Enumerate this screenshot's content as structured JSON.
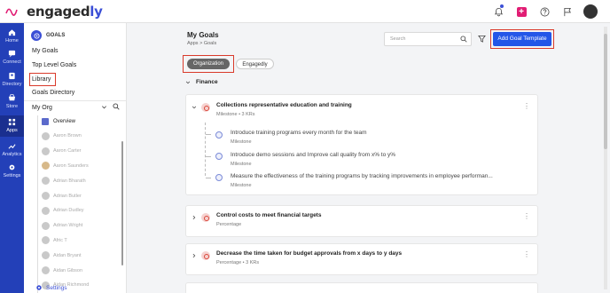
{
  "brand": {
    "name_main": "engaged",
    "name_accent": "ly"
  },
  "rail": [
    {
      "label": "Home",
      "icon": "home-icon"
    },
    {
      "label": "Connect",
      "icon": "connect-icon"
    },
    {
      "label": "Directory",
      "icon": "directory-icon"
    },
    {
      "label": "Store",
      "icon": "store-icon"
    },
    {
      "label": "Apps",
      "icon": "apps-icon"
    },
    {
      "label": "Analytics",
      "icon": "analytics-icon"
    },
    {
      "label": "Settings",
      "icon": "settings-icon"
    }
  ],
  "sidebar": {
    "header": "GOALS",
    "links": [
      "My Goals",
      "Top Level Goals",
      "Library",
      "Goals Directory"
    ],
    "my_org": "My Org",
    "overview": "Overview",
    "people": [
      "Aaron Brown",
      "Aaron Carter",
      "Aaron Saunders",
      "Adrian Bharath",
      "Adrian Butler",
      "Adrian Dudley",
      "Adrian Wright",
      "Afric T",
      "Aidan Bryant",
      "Aidan Gibson",
      "Aidan Richmond"
    ],
    "footer_settings": "Settings"
  },
  "main": {
    "title": "My Goals",
    "breadcrumb": [
      "Apps",
      ">",
      "Goals"
    ],
    "search_placeholder": "Search",
    "add_template_label": "Add Goal Template",
    "tabs": [
      "Organization",
      "Engagedly"
    ],
    "section": "Finance",
    "goals": [
      {
        "title": "Collections representative education and training",
        "meta": "Milestone • 3 KRs",
        "subgoals": [
          {
            "title": "Introduce training programs every month for the team",
            "meta": "Milestone"
          },
          {
            "title": "Introduce demo sessions and Improve call quality from x% to y%",
            "meta": "Milestone"
          },
          {
            "title": "Measure the effectiveness of the training programs by tracking improvements in employee performan...",
            "meta": "Milestone"
          }
        ]
      },
      {
        "title": "Control costs to meet financial targets",
        "meta": "Percentage"
      },
      {
        "title": "Decrease the time taken for budget approvals from x days to y days",
        "meta": "Percentage • 3 KRs"
      }
    ]
  },
  "colors": {
    "rail": "#2340b8",
    "accent": "#2356e8",
    "highlight": "#d93a2b"
  }
}
